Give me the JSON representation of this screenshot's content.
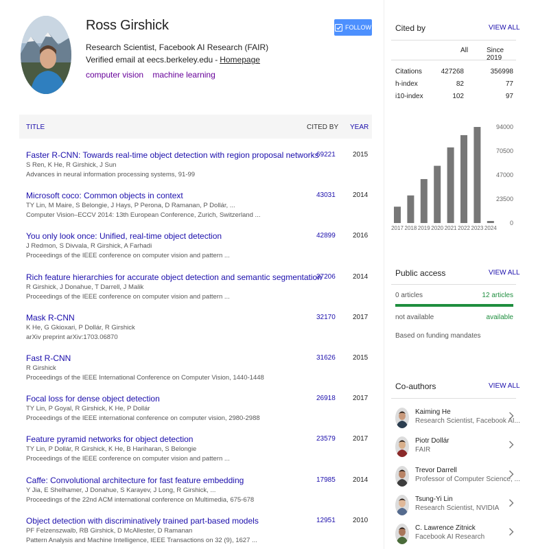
{
  "profile": {
    "name": "Ross Girshick",
    "affiliation": "Research Scientist, Facebook AI Research (FAIR)",
    "email_text": "Verified email at eecs.berkeley.edu",
    "email_sep": "-",
    "homepage_label": "Homepage",
    "interests": [
      "computer vision",
      "machine learning"
    ],
    "follow_label": "FOLLOW"
  },
  "table": {
    "col_title": "TITLE",
    "col_cited": "CITED BY",
    "col_year": "YEAR",
    "rows": [
      {
        "title": "Faster R-CNN: Towards real-time object detection with region proposal networks",
        "authors": "S Ren, K He, R Girshick, J Sun",
        "venue": "Advances in neural information processing systems, 91-99",
        "cited": "69221",
        "year": "2015"
      },
      {
        "title": "Microsoft coco: Common objects in context",
        "authors": "TY Lin, M Maire, S Belongie, J Hays, P Perona, D Ramanan, P Dollár, ...",
        "venue": "Computer Vision–ECCV 2014: 13th European Conference, Zurich, Switzerland ...",
        "cited": "43031",
        "year": "2014"
      },
      {
        "title": "You only look once: Unified, real-time object detection",
        "authors": "J Redmon, S Divvala, R Girshick, A Farhadi",
        "venue": "Proceedings of the IEEE conference on computer vision and pattern ...",
        "cited": "42899",
        "year": "2016"
      },
      {
        "title": "Rich feature hierarchies for accurate object detection and semantic segmentation",
        "authors": "R Girshick, J Donahue, T Darrell, J Malik",
        "venue": "Proceedings of the IEEE conference on computer vision and pattern ...",
        "cited": "37206",
        "year": "2014"
      },
      {
        "title": "Mask R-CNN",
        "authors": "K He, G Gkioxari, P Dollár, R Girshick",
        "venue": "arXiv preprint arXiv:1703.06870",
        "cited": "32170",
        "year": "2017"
      },
      {
        "title": "Fast R-CNN",
        "authors": "R Girshick",
        "venue": "Proceedings of the IEEE International Conference on Computer Vision, 1440-1448",
        "cited": "31626",
        "year": "2015"
      },
      {
        "title": "Focal loss for dense object detection",
        "authors": "TY Lin, P Goyal, R Girshick, K He, P Dollár",
        "venue": "Proceedings of the IEEE international conference on computer vision, 2980-2988",
        "cited": "26918",
        "year": "2017"
      },
      {
        "title": "Feature pyramid networks for object detection",
        "authors": "TY Lin, P Dollár, R Girshick, K He, B Hariharan, S Belongie",
        "venue": "Proceedings of the IEEE conference on computer vision and pattern ...",
        "cited": "23579",
        "year": "2017"
      },
      {
        "title": "Caffe: Convolutional architecture for fast feature embedding",
        "authors": "Y Jia, E Shelhamer, J Donahue, S Karayev, J Long, R Girshick, ...",
        "venue": "Proceedings of the 22nd ACM international conference on Multimedia, 675-678",
        "cited": "17985",
        "year": "2014"
      },
      {
        "title": "Object detection with discriminatively trained part-based models",
        "authors": "PF Felzenszwalb, RB Girshick, D McAllester, D Ramanan",
        "venue": "Pattern Analysis and Machine Intelligence, IEEE Transactions on 32 (9), 1627 ...",
        "cited": "12951",
        "year": "2010"
      }
    ]
  },
  "cited_by": {
    "title": "Cited by",
    "view_all": "VIEW ALL",
    "col_all": "All",
    "col_since": "Since 2019",
    "rows": [
      {
        "label": "Citations",
        "all": "427268",
        "since": "356998"
      },
      {
        "label": "h-index",
        "all": "82",
        "since": "77"
      },
      {
        "label": "i10-index",
        "all": "102",
        "since": "97"
      }
    ]
  },
  "chart_data": {
    "type": "bar",
    "categories": [
      "2017",
      "2018",
      "2019",
      "2020",
      "2021",
      "2022",
      "2023",
      "2024"
    ],
    "values": [
      16000,
      27000,
      43000,
      56000,
      74000,
      86000,
      94000,
      2000
    ],
    "yticks": [
      "94000",
      "70500",
      "47000",
      "23500",
      "0"
    ],
    "ylim": [
      0,
      94000
    ],
    "bar_color": "#777777"
  },
  "public_access": {
    "title": "Public access",
    "view_all": "VIEW ALL",
    "left_count": "0 articles",
    "right_count": "12 articles",
    "left_status": "not available",
    "right_status": "available",
    "note": "Based on funding mandates"
  },
  "coauthors": {
    "title": "Co-authors",
    "view_all": "VIEW ALL",
    "list": [
      {
        "name": "Kaiming He",
        "sub": "Research Scientist, Facebook AI..."
      },
      {
        "name": "Piotr Dollár",
        "sub": "FAIR"
      },
      {
        "name": "Trevor Darrell",
        "sub": "Professor of Computer Science, ..."
      },
      {
        "name": "Tsung-Yi Lin",
        "sub": "Research Scientist, NVIDIA"
      },
      {
        "name": "C. Lawrence Zitnick",
        "sub": "Facebook AI Research"
      }
    ]
  },
  "colors": {
    "link": "#1a0dab",
    "interest": "#660099",
    "follow_bg": "#4d90fe",
    "available": "#1e8e3e"
  }
}
